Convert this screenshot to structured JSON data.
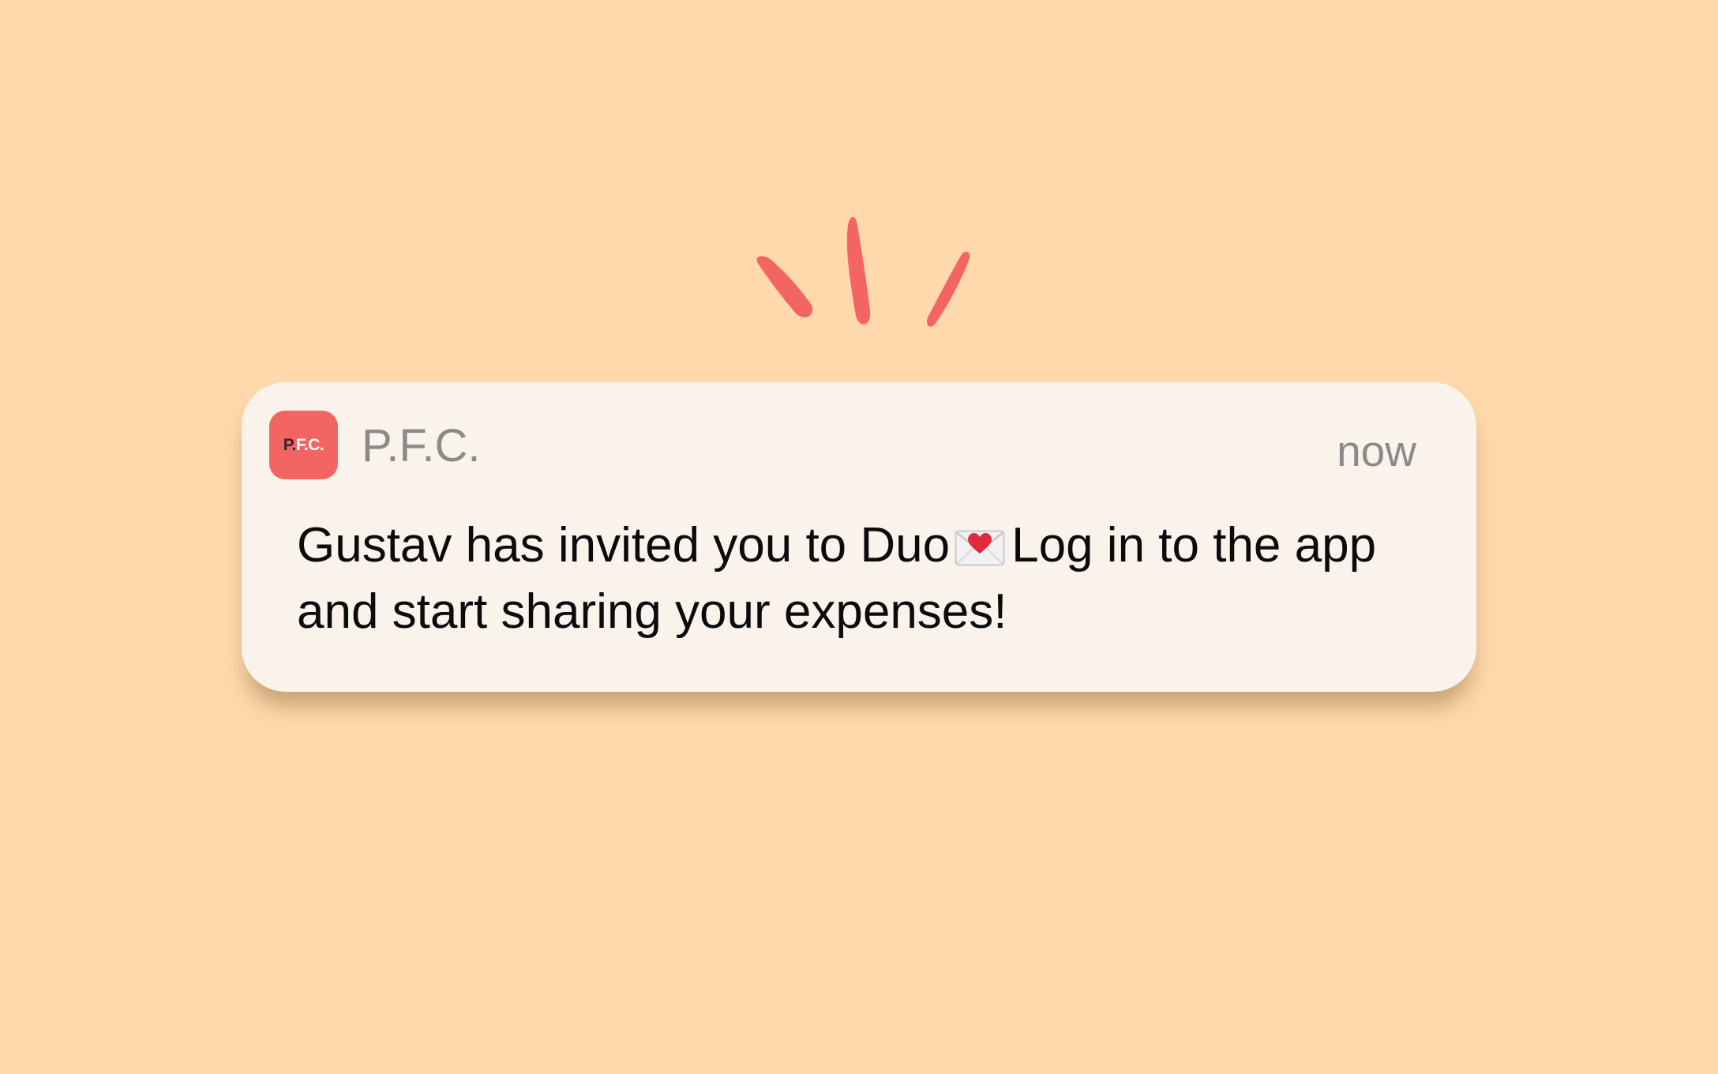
{
  "notification": {
    "app_icon_text_first": "P.",
    "app_icon_text_rest": "F.C.",
    "app_name": "P.F.C.",
    "timestamp": "now",
    "message_part1": "Gustav has invited you to Duo",
    "message_part2": "Log in to the app and start sharing your expenses!",
    "emoji_icon": "love-letter-icon"
  },
  "colors": {
    "background": "#ffd9ab",
    "card": "#f9f3ec",
    "accent": "#f26563",
    "muted_text": "#8c8a88",
    "body_text": "#0b0b0b"
  }
}
